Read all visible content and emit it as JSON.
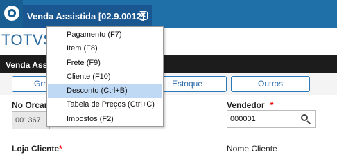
{
  "colors": {
    "topbar": "#1f6fa8",
    "tab": "#1a5690",
    "accent": "#2b78b8",
    "required": "#e00000",
    "menu_highlight": "#bfd8f3"
  },
  "app": {
    "logo_icon": "totvs-logo-icon",
    "tab_title": "Venda Assistida [02.9.0012]",
    "tab_close_glyph": "✕",
    "brand": "TOTVS"
  },
  "darkbar": {
    "title": "Venda Assis"
  },
  "buttons": {
    "gravar": "Grav",
    "estoque": "Estoque",
    "outros": "Outros"
  },
  "form": {
    "no_orcamento_label": "No Orcam",
    "no_orcamento_value": "001367",
    "vendedor_label": "Vendedor",
    "vendedor_value": "000001",
    "required_mark": "*",
    "loja_cliente_label": "Loja Cliente",
    "nome_cliente_label": "Nome Cliente"
  },
  "menu": {
    "items": [
      "Pagamento (F7)",
      "Item (F8)",
      "Frete (F9)",
      "Cliente (F10)",
      "Desconto (Ctrl+B)",
      "Tabela de Preços (Ctrl+C)",
      "Impostos (F2)"
    ],
    "highlighted_item": "Desconto (Ctrl+B)"
  }
}
